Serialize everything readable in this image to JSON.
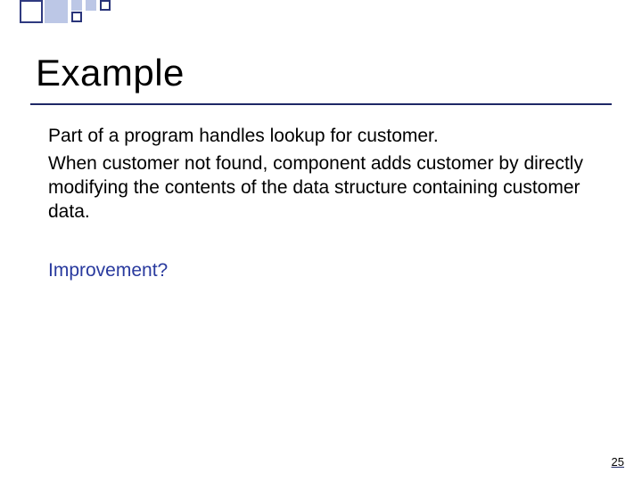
{
  "slide": {
    "title": "Example",
    "body_line1": "Part of a program handles lookup for customer.",
    "body_line2": "When customer not found, component adds customer by directly modifying the contents of the data structure containing customer data.",
    "improvement": "Improvement?",
    "page_number": "25"
  }
}
